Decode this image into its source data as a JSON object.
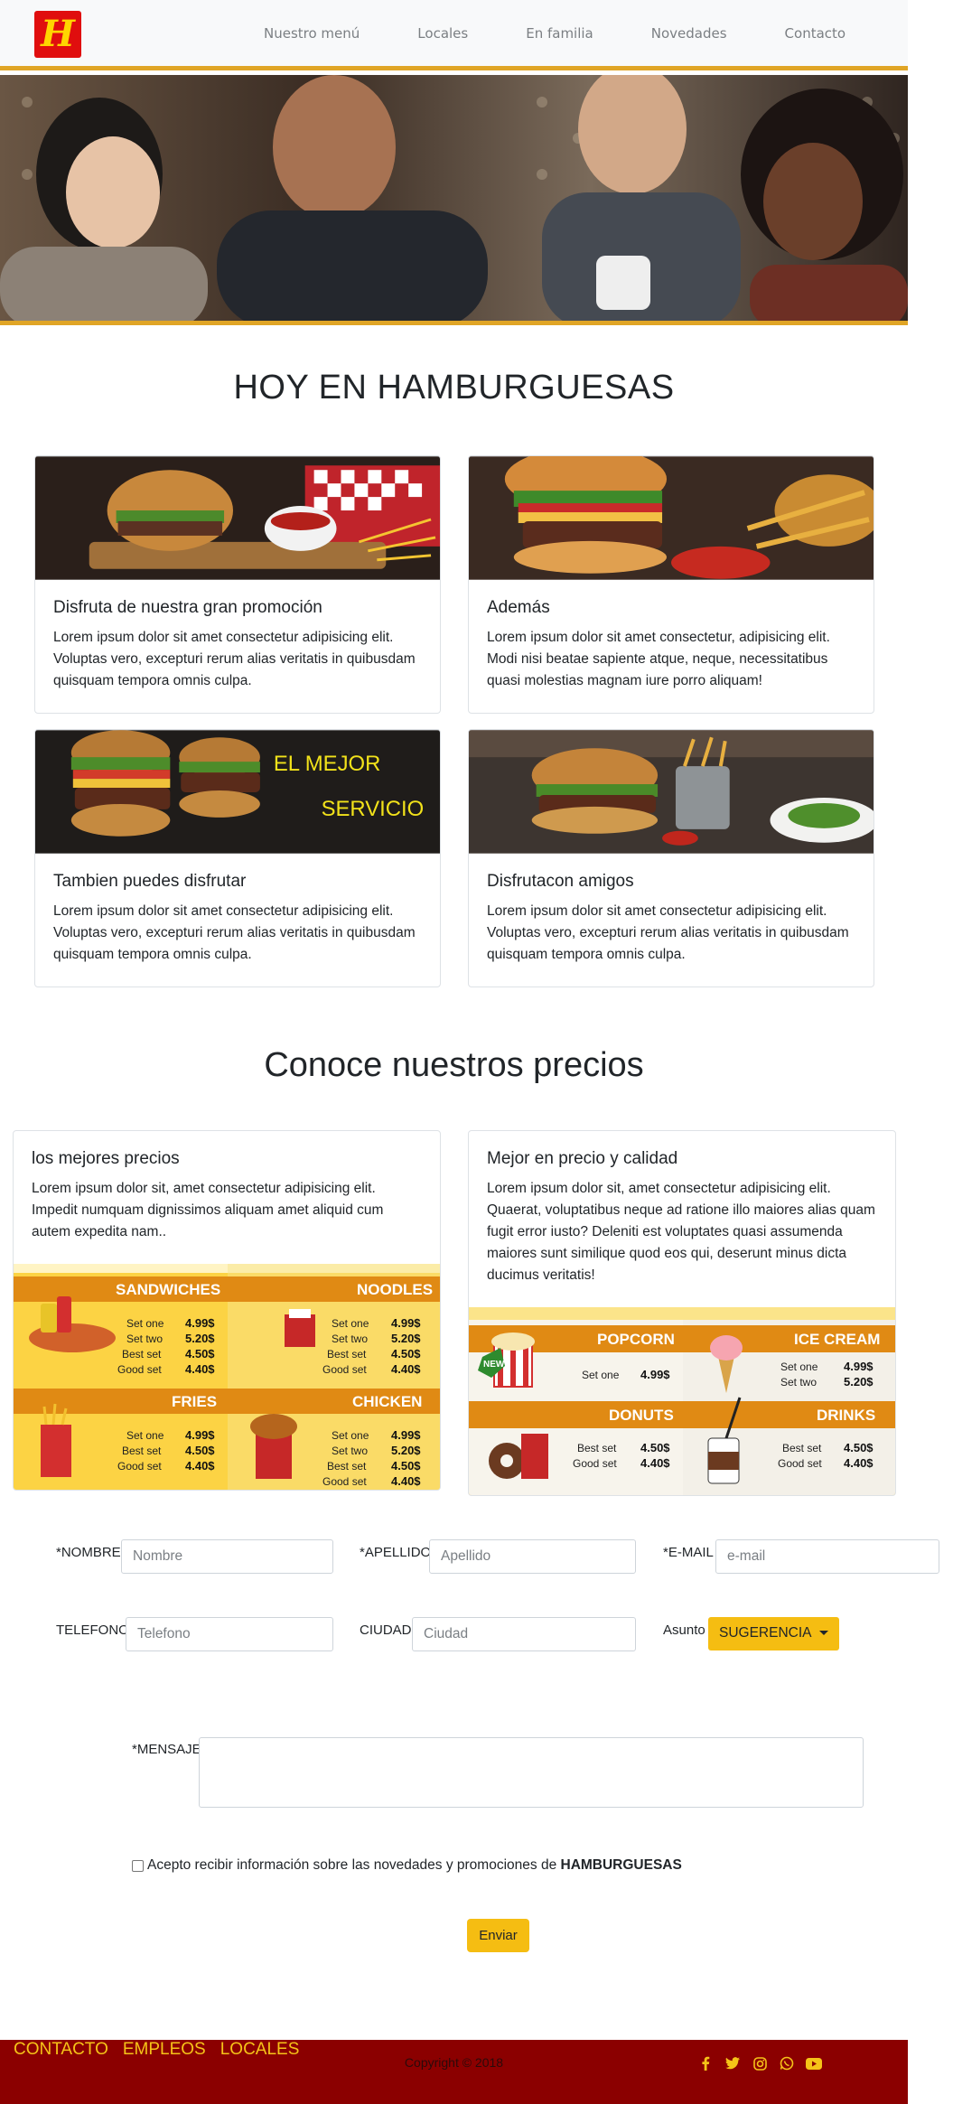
{
  "nav": {
    "logo_letter": "H",
    "links": [
      "Nuestro menú",
      "Locales",
      "En familia",
      "Novedades",
      "Contacto"
    ]
  },
  "sections": {
    "today_title": "HOY EN HAMBURGUESAS",
    "prices_title": "Conoce nuestros precios"
  },
  "cards": [
    {
      "title": "Disfruta de nuestra gran promoción",
      "text": "Lorem ipsum dolor sit amet consectetur adipisicing elit. Voluptas vero, excepturi rerum alias veritatis in quibusdam quisquam tempora omnis culpa."
    },
    {
      "title": "Además",
      "text": "Lorem ipsum dolor sit amet consectetur, adipisicing elit. Modi nisi beatae sapiente atque, neque, necessitatibus quasi molestias magnam iure porro aliquam!"
    },
    {
      "title": "Tambien puedes disfrutar",
      "text": "Lorem ipsum dolor sit amet consectetur adipisicing elit. Voluptas vero, excepturi rerum alias veritatis in quibusdam quisquam tempora omnis culpa.",
      "banner_line1": "EL MEJOR",
      "banner_line2": "SERVICIO"
    },
    {
      "title": "Disfrutacon amigos",
      "text": "Lorem ipsum dolor sit amet consectetur adipisicing elit. Voluptas vero, excepturi rerum alias veritatis in quibusdam quisquam tempora omnis culpa."
    }
  ],
  "price_cards": [
    {
      "title": "los mejores precios",
      "text": "Lorem ipsum dolor sit, amet consectetur adipisicing elit. Impedit numquam dignissimos aliquam amet aliquid cum autem expedita nam..",
      "menu": [
        {
          "name": "SANDWICHES",
          "rows": [
            [
              "Set one",
              "4.99$"
            ],
            [
              "Set two",
              "5.20$"
            ],
            [
              "Best set",
              "4.50$"
            ],
            [
              "Good set",
              "4.40$"
            ]
          ]
        },
        {
          "name": "NOODLES",
          "rows": [
            [
              "Set one",
              "4.99$"
            ],
            [
              "Set two",
              "5.20$"
            ],
            [
              "Best set",
              "4.50$"
            ],
            [
              "Good set",
              "4.40$"
            ]
          ]
        },
        {
          "name": "FRIES",
          "rows": [
            [
              "Set one",
              "4.99$"
            ],
            [
              "Best set",
              "4.50$"
            ],
            [
              "Good set",
              "4.40$"
            ]
          ]
        },
        {
          "name": "CHICKEN",
          "rows": [
            [
              "Set one",
              "4.99$"
            ],
            [
              "Set two",
              "5.20$"
            ],
            [
              "Best set",
              "4.50$"
            ],
            [
              "Good set",
              "4.40$"
            ]
          ]
        }
      ]
    },
    {
      "title": "Mejor en precio y calidad",
      "text": "Lorem ipsum dolor sit, amet consectetur adipisicing elit. Quaerat, voluptatibus neque ad ratione illo maiores alias quam fugit error iusto? Deleniti est voluptates quasi assumenda maiores sunt similique quod eos qui, deserunt minus dicta ducimus veritatis!",
      "menu": [
        {
          "name": "POPCORN",
          "rows": [
            [
              "Set one",
              "4.99$"
            ]
          ],
          "badge": "NEW!"
        },
        {
          "name": "ICE CREAM",
          "rows": [
            [
              "Set one",
              "4.99$"
            ],
            [
              "Set two",
              "5.20$"
            ]
          ]
        },
        {
          "name": "DONUTS",
          "rows": [
            [
              "Best set",
              "4.50$"
            ],
            [
              "Good set",
              "4.40$"
            ]
          ]
        },
        {
          "name": "DRINKS",
          "rows": [
            [
              "Best set",
              "4.50$"
            ],
            [
              "Good set",
              "4.40$"
            ]
          ]
        }
      ]
    }
  ],
  "form": {
    "nombre_label": "*NOMBRE",
    "nombre_placeholder": "Nombre",
    "apellido_label": "*APELLIDO",
    "apellido_placeholder": "Apellido",
    "email_label": "*E-MAIL",
    "email_placeholder": "e-mail",
    "telefono_label": "TELEFONO",
    "telefono_placeholder": "Telefono",
    "ciudad_label": "CIUDAD",
    "ciudad_placeholder": "Ciudad",
    "asunto_label": "Asunto",
    "asunto_value": "SUGERENCIA",
    "mensaje_label": "*MENSAJE",
    "consent_text": "Acepto recibir información sobre las novedades y promociones de",
    "consent_brand": "HAMBURGUESAS",
    "submit_label": "Enviar"
  },
  "footer": {
    "links": [
      "CONTACTO",
      "EMPLEOS",
      "LOCALES"
    ],
    "copyright": "Copyright © 2018",
    "socials": [
      "facebook-icon",
      "twitter-icon",
      "instagram-icon",
      "whatsapp-icon",
      "youtube-icon"
    ]
  },
  "colors": {
    "accent": "#e0a526",
    "button": "#f5bd12",
    "footer_bg": "#8b0000",
    "footer_link": "#f5c318",
    "logo_bg": "#e00e0e"
  }
}
